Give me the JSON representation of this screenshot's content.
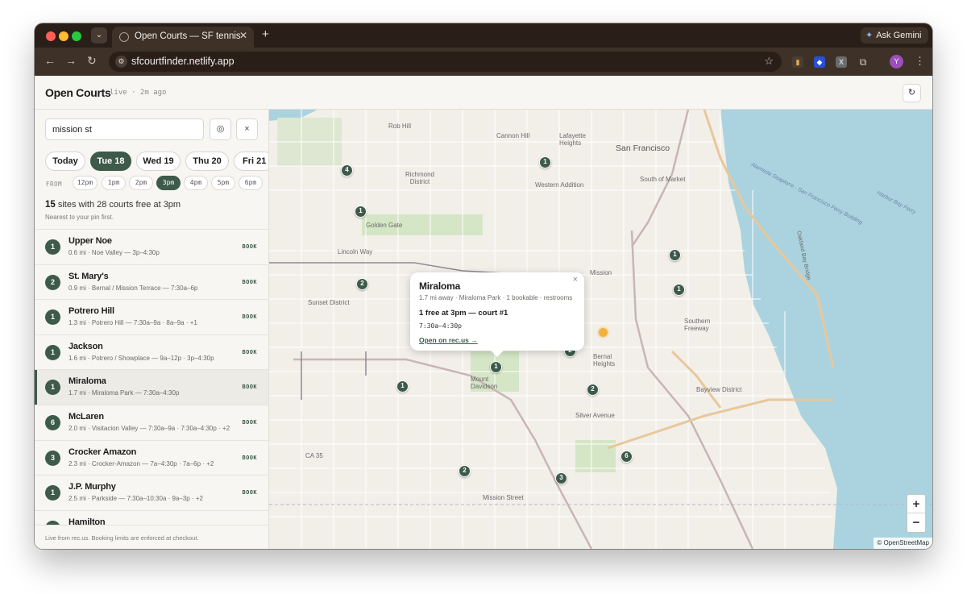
{
  "browser": {
    "tab_title": "Open Courts — SF tennis",
    "new_tab": "+",
    "tab_close": "✕",
    "url": "sfcourtfinder.netlify.app",
    "ask_gemini": "Ask Gemini",
    "profile_initial": "Y"
  },
  "header": {
    "title": "Open Courts",
    "status": "live · 2m ago",
    "refresh_icon": "↻"
  },
  "search": {
    "value": "mission st",
    "locate_icon": "◎",
    "clear_icon": "×"
  },
  "days": [
    {
      "label": "Today",
      "active": false
    },
    {
      "label": "Tue 18",
      "active": true
    },
    {
      "label": "Wed 19",
      "active": false
    },
    {
      "label": "Thu 20",
      "active": false
    },
    {
      "label": "Fri 21",
      "active": false
    }
  ],
  "from_label": "FROM",
  "times": [
    "12pm",
    "1pm",
    "2pm",
    "3pm",
    "4pm",
    "5pm",
    "6pm"
  ],
  "active_time": "3pm",
  "summary": {
    "count": "15",
    "text": " sites with 28 courts free at 3pm",
    "sub": "Nearest to your pin first."
  },
  "book_label": "BOOK",
  "sites": [
    {
      "n": "1",
      "name": "Upper Noe",
      "sub": "0.6 mi · Noe Valley — 3p–4:30p"
    },
    {
      "n": "2",
      "name": "St. Mary's",
      "sub": "0.9 mi · Bernal / Mission Terrace — 7:30a–6p"
    },
    {
      "n": "1",
      "name": "Potrero Hill",
      "sub": "1.3 mi · Potrero Hill — 7:30a–9a · 8a–9a · +1"
    },
    {
      "n": "1",
      "name": "Jackson",
      "sub": "1.6 mi · Potrero / Showplace — 9a–12p · 3p–4:30p"
    },
    {
      "n": "1",
      "name": "Miraloma",
      "sub": "1.7 mi · Miraloma Park — 7:30a–4:30p",
      "selected": true
    },
    {
      "n": "6",
      "name": "McLaren",
      "sub": "2.0 mi · Visitacion Valley — 7:30a–9a · 7:30a–4:30p · +2"
    },
    {
      "n": "3",
      "name": "Crocker Amazon",
      "sub": "2.3 mi · Crocker-Amazon — 7a–4:30p · 7a–6p · +2"
    },
    {
      "n": "1",
      "name": "J.P. Murphy",
      "sub": "2.5 mi · Parkside — 7:30a–10:30a · 9a–3p · +2"
    },
    {
      "n": "1",
      "name": "Hamilton",
      "sub": ""
    }
  ],
  "footer": "Live from rec.us. Booking limits are enforced at checkout.",
  "popup": {
    "title": "Miraloma",
    "sub": "1.7 mi away · Miraloma Park · 1 bookable · restrooms",
    "free": "1 free at 3pm — court #1",
    "time": "7:30a–4:30p",
    "link": "Open on rec.us →",
    "close": "×"
  },
  "map_pins": [
    "4",
    "1",
    "1",
    "2",
    "1",
    "1",
    "2",
    "1",
    "2",
    "6",
    "3",
    "2"
  ],
  "map_labels": {
    "san_francisco": "San Francisco",
    "south_of_market": "South of Market",
    "richmond": "Richmond District",
    "western_addition": "Western Addition",
    "sunset": "Sunset District",
    "mission": "Mission",
    "bayview": "Bayview District",
    "bernal": "Bernal Heights",
    "golden_gate": "Golden Gate",
    "mount_davidson": "Mount Davidson",
    "lincoln": "Lincoln Way",
    "southern_freeway": "Southern Freeway",
    "oakland_bay": "Oakland Bay Bridge",
    "silver": "Silver Avenue",
    "mission_street": "Mission Street",
    "ca35": "CA 35",
    "rob_hill": "Rob Hill",
    "lafayette": "Lafayette Heights",
    "cannon": "Cannon Hill",
    "alameda": "Alameda Seaplane - San Francisco Ferry Building",
    "harbor": "Harbor Bay Ferry"
  },
  "attribution": "© OpenStreetMap",
  "zoom": {
    "in": "+",
    "out": "−"
  },
  "colors": {
    "accent": "#3d5a4a",
    "my_location": "#f0b23a",
    "water": "#aad3df"
  }
}
